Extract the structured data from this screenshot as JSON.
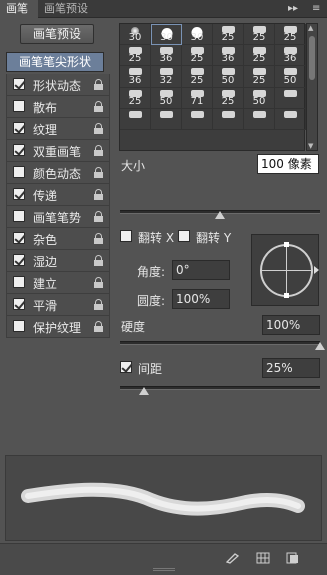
{
  "tabs": [
    "画笔",
    "画笔预设"
  ],
  "preset_button": "画笔预设",
  "tip_shape_label": "画笔笔尖形状",
  "options": [
    {
      "label": "形状动态",
      "checked": true
    },
    {
      "label": "散布",
      "checked": false
    },
    {
      "label": "纹理",
      "checked": true
    },
    {
      "label": "双重画笔",
      "checked": true
    },
    {
      "label": "颜色动态",
      "checked": false
    },
    {
      "label": "传递",
      "checked": true
    },
    {
      "label": "画笔笔势",
      "checked": false
    },
    {
      "label": "杂色",
      "checked": true
    },
    {
      "label": "湿边",
      "checked": true
    },
    {
      "label": "建立",
      "checked": false
    },
    {
      "label": "平滑",
      "checked": true
    },
    {
      "label": "保护纹理",
      "checked": false
    }
  ],
  "brush_sizes": [
    "30",
    "30",
    "30",
    "25",
    "25",
    "25",
    "25",
    "36",
    "25",
    "36",
    "25",
    "36",
    "36",
    "32",
    "25",
    "50",
    "25",
    "50",
    "25",
    "50",
    "71",
    "25",
    "50",
    "",
    "",
    "",
    "",
    "",
    "",
    ""
  ],
  "size": {
    "label": "大小",
    "value": "100 像素",
    "slider": 0.5
  },
  "flip_x": {
    "label": "翻转 X",
    "checked": false
  },
  "flip_y": {
    "label": "翻转 Y",
    "checked": false
  },
  "angle": {
    "label": "角度:",
    "value": "0°"
  },
  "roundness": {
    "label": "圆度:",
    "value": "100%"
  },
  "hardness": {
    "label": "硬度",
    "value": "100%",
    "slider": 1.0
  },
  "spacing": {
    "label": "间距",
    "value": "25%",
    "checked": true,
    "slider": 0.12
  },
  "icons": [
    "collapse-arrows-icon",
    "panel-menu-icon",
    "brush-preview-icon",
    "grid-icon",
    "new-preset-icon"
  ]
}
